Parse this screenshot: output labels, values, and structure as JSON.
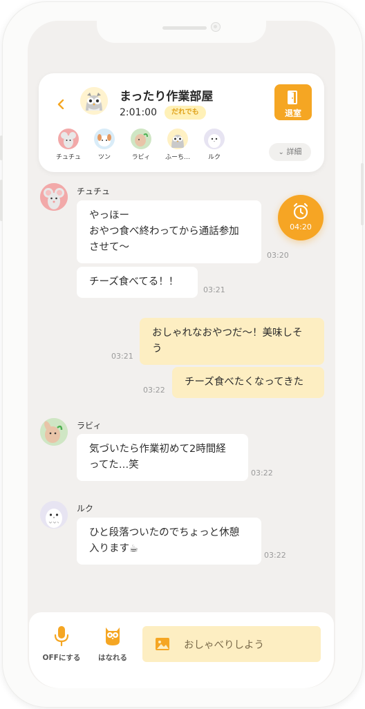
{
  "room": {
    "title": "まったり作業部屋",
    "elapsed": "2:01:00",
    "tag": "だれでも",
    "leave_label": "退室",
    "detail_label": "詳細"
  },
  "members": [
    {
      "name": "チュチュ",
      "color": "#f2a9a9"
    },
    {
      "name": "ツン",
      "color": "#d9ecf8"
    },
    {
      "name": "ラビィ",
      "color": "#cfe6c4"
    },
    {
      "name": "ふーち…",
      "color": "#fff1c4"
    },
    {
      "name": "ルク",
      "color": "#e7e4f2"
    }
  ],
  "timer": {
    "label": "04:20"
  },
  "messages": [
    {
      "sender": "チュチュ",
      "text": "やっほー\nおやつ食べ終わってから通話参加させて〜",
      "time": "03:20"
    },
    {
      "text": "チーズ食べてる！！",
      "time": "03:21"
    },
    {
      "text": "おしゃれなおやつだ〜！美味しそう",
      "time": "03:21"
    },
    {
      "text": "チーズ食べたくなってきた",
      "time": "03:22"
    },
    {
      "sender": "ラビィ",
      "text": "気づいたら作業初めて2時間経ってた…笑",
      "time": "03:22"
    },
    {
      "sender": "ルク",
      "text": "ひと段落ついたのでちょっと休憩入ります☕",
      "time": "03:22"
    }
  ],
  "bottom": {
    "mic_label": "OFFにする",
    "leave_label": "はなれる",
    "input_placeholder": "おしゃべりしよう"
  },
  "colors": {
    "accent": "#f5a623",
    "outgoing_bubble": "#fdeec2",
    "background": "#f2f0ee"
  }
}
